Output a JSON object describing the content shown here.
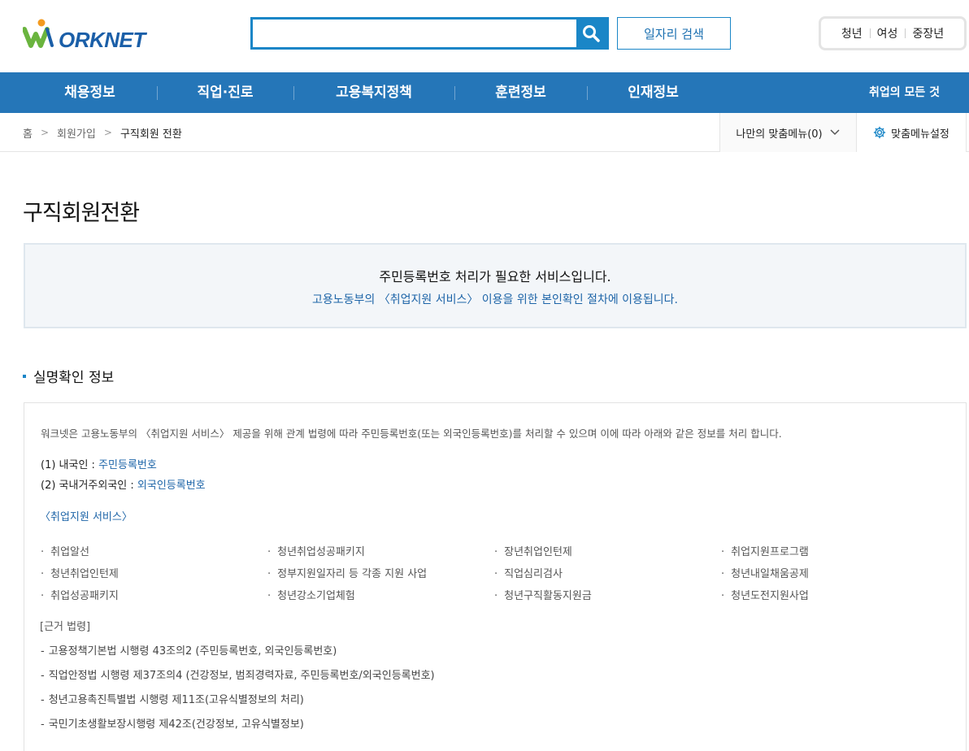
{
  "header": {
    "logo_text": "ORKNET",
    "search_placeholder": "",
    "job_search_label": "일자리 검색",
    "targets": [
      "청년",
      "여성",
      "중장년"
    ]
  },
  "nav": {
    "items": [
      "채용정보",
      "직업·진로",
      "고용복지정책",
      "훈련정보",
      "인재정보"
    ],
    "all_label": "취업의 모든 것"
  },
  "breadcrumb": {
    "home": "홈",
    "level1": "회원가입",
    "current": "구직회원 전환"
  },
  "my_menu": {
    "label": "나만의 맞춤메뉴(0)",
    "settings_label": "맞춤메뉴설정"
  },
  "page_title": "구직회원전환",
  "notice": {
    "title": "주민등록번호 처리가 필요한 서비스입니다.",
    "subtitle": "고용노동부의 〈취업지원 서비스〉 이용을 위한 본인확인 절차에 이용됩니다."
  },
  "section": {
    "title": "실명확인 정보",
    "intro": "워크넷은 고용노동부의 〈취업지원 서비스〉 제공을 위해 관계 법령에 따라 주민등록번호(또는 외국인등록번호)를 처리할 수 있으며 이에 따라 아래와 같은 정보를 처리 합니다.",
    "line1_label": "(1) 내국인 : ",
    "line1_value": "주민등록번호",
    "line2_label": "(2) 국내거주외국인 : ",
    "line2_value": "외국인등록번호",
    "services_title": "〈취업지원 서비스〉",
    "services": [
      "취업알선",
      "청년취업성공패키지",
      "장년취업인턴제",
      "취업지원프로그램",
      "청년취업인턴제",
      "정부지원일자리 등 각종 지원 사업",
      "직업심리검사",
      "청년내일채움공제",
      "취업성공패키지",
      "청년강소기업체험",
      "청년구직활동지원금",
      "청년도전지원사업"
    ],
    "law_title": "[근거 법령]",
    "laws": [
      "고용정책기본법 시행령 43조의2 (주민등록번호, 외국인등록번호)",
      "직업안정법 시행령 제37조의4 (건강정보, 범죄경력자료, 주민등록번호/외국인등록번호)",
      "청년고용촉진특별법 시행령 제11조(고유식별정보의 처리)",
      "국민기초생활보장시행령 제42조(건강정보, 고유식별정보)"
    ]
  },
  "colors": {
    "brand_blue": "#2576b8",
    "accent_blue": "#1a86c7",
    "logo_green": "#6ab43e",
    "logo_orange": "#f39a1e"
  }
}
